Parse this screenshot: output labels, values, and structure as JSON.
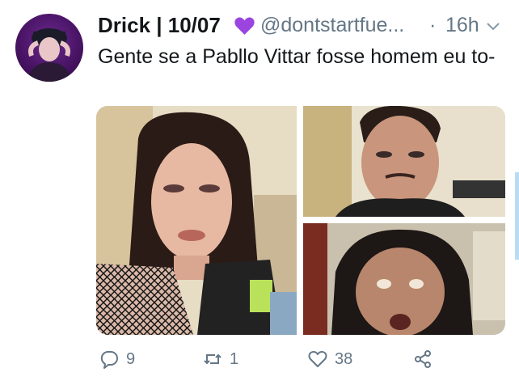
{
  "tweet": {
    "display_name": "Drick | 10/07",
    "emoji": "purple-heart",
    "handle": "@dontstartfue...",
    "separator": "·",
    "time": "16h",
    "text": "Gente se a Pabllo Vittar fosse homem eu to-"
  },
  "actions": {
    "replies": "9",
    "retweets": "1",
    "likes": "38"
  },
  "icons": {
    "reply": "comment-bubble-icon",
    "retweet": "retweet-icon",
    "like": "heart-outline-icon",
    "share": "share-icon",
    "menu": "chevron-down-icon"
  },
  "colors": {
    "text": "#14171a",
    "secondary": "#657786",
    "heart_emoji": "#9b44e0",
    "scroll_accent": "#b9dcf4"
  }
}
